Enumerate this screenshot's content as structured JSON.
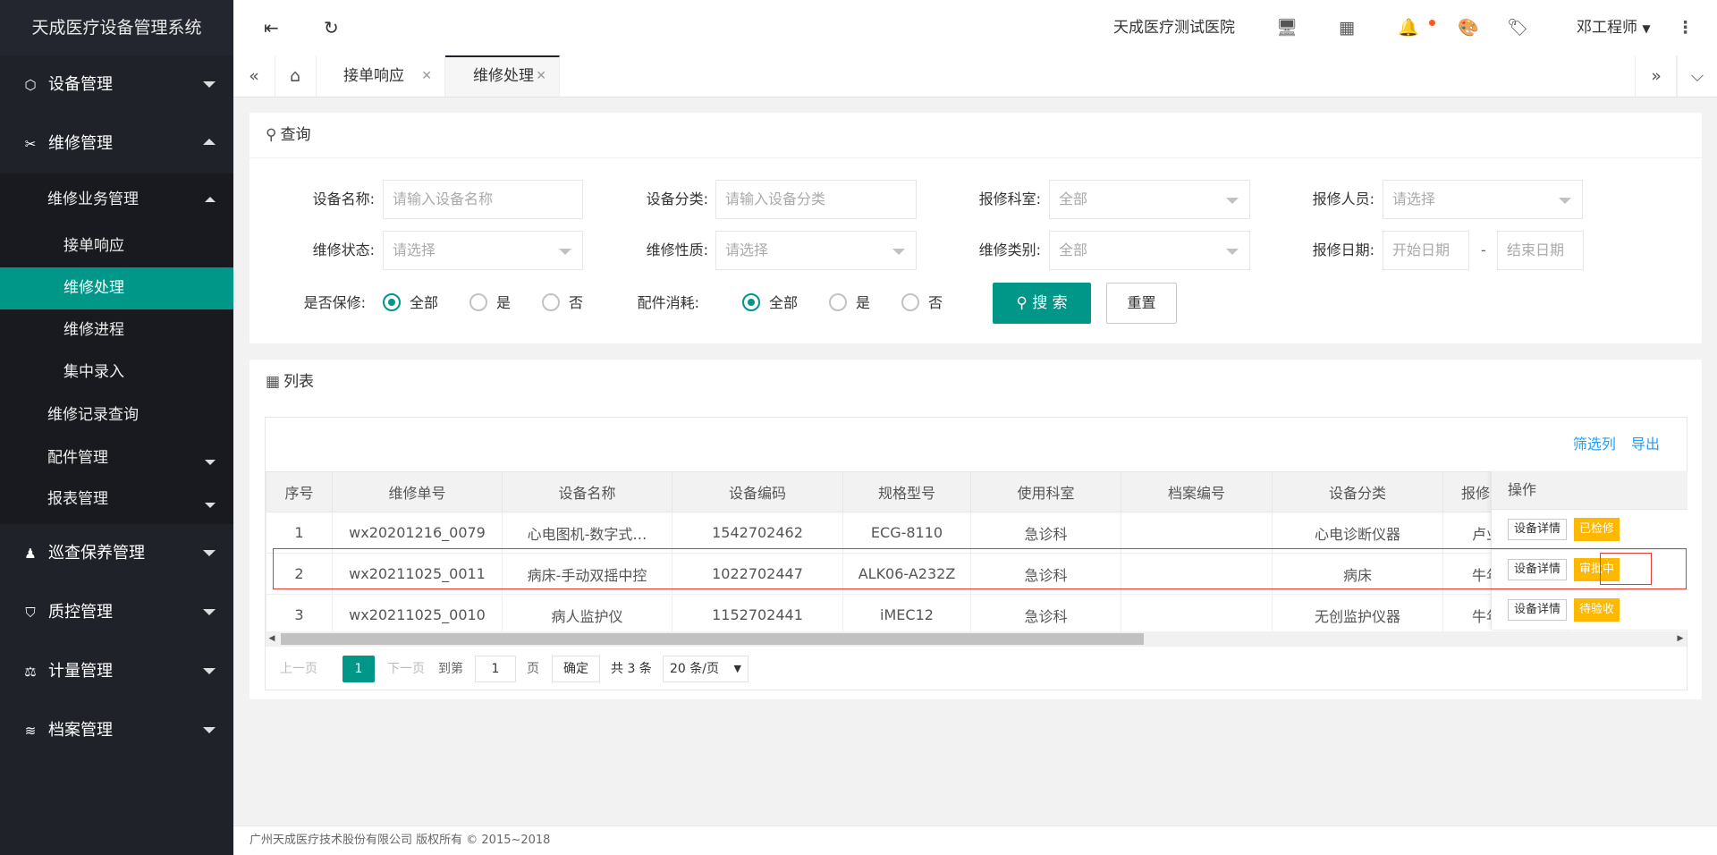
{
  "app": {
    "title": "天成医疗设备管理系统"
  },
  "sidebar": {
    "m1": "设备管理",
    "m2": "维修管理",
    "m2_sub1": "维修业务管理",
    "m2_sub1_a": "接单响应",
    "m2_sub1_b": "维修处理",
    "m2_sub1_c": "维修进程",
    "m2_sub1_d": "集中录入",
    "m2_sub2": "维修记录查询",
    "m2_sub3": "配件管理",
    "m2_sub4": "报表管理",
    "m3": "巡查保养管理",
    "m4": "质控管理",
    "m5": "计量管理",
    "m6": "档案管理"
  },
  "header": {
    "hospital": "天成医疗测试医院",
    "user": "邓工程师"
  },
  "tabs": {
    "t1": "接单响应",
    "t2": "维修处理"
  },
  "query": {
    "title": "查询",
    "f_name_label": "设备名称:",
    "f_name_ph": "请输入设备名称",
    "f_cat_label": "设备分类:",
    "f_cat_ph": "请输入设备分类",
    "f_dept_label": "报修科室:",
    "f_dept_val": "全部",
    "f_person_label": "报修人员:",
    "f_person_val": "请选择",
    "f_status_label": "维修状态:",
    "f_status_val": "请选择",
    "f_nature_label": "维修性质:",
    "f_nature_val": "请选择",
    "f_type_label": "维修类别:",
    "f_type_val": "全部",
    "f_date_label": "报修日期:",
    "f_date_start": "开始日期",
    "f_date_sep": "-",
    "f_date_end": "结束日期",
    "f_warranty_label": "是否保修:",
    "f_parts_label": "配件消耗:",
    "opt_all": "全部",
    "opt_yes": "是",
    "opt_no": "否",
    "search_btn": "搜 索",
    "reset_btn": "重置"
  },
  "list": {
    "title": "列表",
    "filter_cols": "筛选列",
    "export": "导出",
    "columns": [
      "序号",
      "维修单号",
      "设备名称",
      "设备编码",
      "规格型号",
      "使用科室",
      "档案编号",
      "设备分类",
      "报修人"
    ],
    "ops_header": "操作",
    "detail_btn": "设备详情",
    "rows": [
      {
        "no": "1",
        "order": "wx20201216_0079",
        "name": "心电图机-数字式…",
        "code": "1542702462",
        "model": "ECG-8110",
        "dept": "急诊科",
        "archive": "",
        "category": "心电诊断仪器",
        "reporter": "卢业兴",
        "status": "已检修"
      },
      {
        "no": "2",
        "order": "wx20211025_0011",
        "name": "病床-手动双摇中控",
        "code": "1022702447",
        "model": "ALK06-A232Z",
        "dept": "急诊科",
        "archive": "",
        "category": "病床",
        "reporter": "牛年",
        "status": "审批中"
      },
      {
        "no": "3",
        "order": "wx20211025_0010",
        "name": "病人监护仪",
        "code": "1152702441",
        "model": "iMEC12",
        "dept": "急诊科",
        "archive": "",
        "category": "无创监护仪器",
        "reporter": "牛年",
        "status": "待验收"
      }
    ]
  },
  "pager": {
    "prev": "上一页",
    "current": "1",
    "next": "下一页",
    "goto": "到第",
    "page_input": "1",
    "page_unit": "页",
    "confirm": "确定",
    "total": "共 3 条",
    "page_size": "20 条/页"
  },
  "footer": {
    "copyright": "广州天成医疗技术股份有限公司 版权所有 © 2015~2018"
  }
}
